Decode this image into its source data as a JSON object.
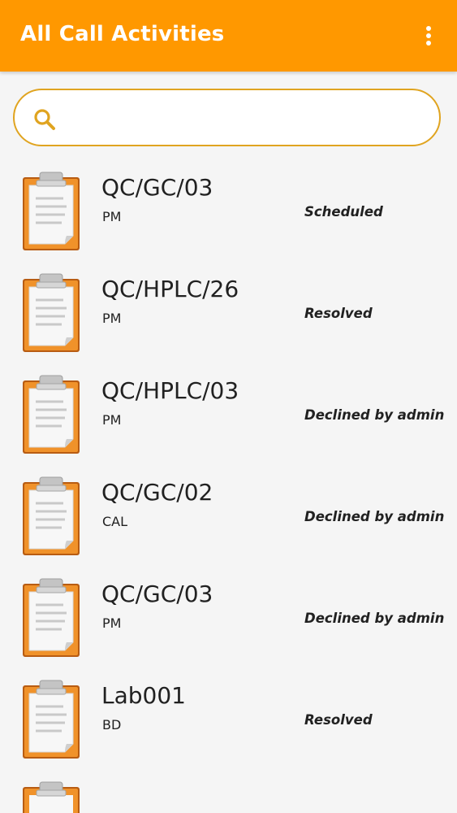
{
  "app_bar": {
    "title": "All Call Activities",
    "menu_icon": "more-vert-icon",
    "color": "#ff9800"
  },
  "search": {
    "icon": "search-icon",
    "value": "",
    "placeholder": "",
    "border_color": "#e0a420"
  },
  "activities": [
    {
      "title": "QC/GC/03",
      "type": "PM",
      "status": "Scheduled",
      "icon": "clipboard-icon"
    },
    {
      "title": "QC/HPLC/26",
      "type": "PM",
      "status": "Resolved",
      "icon": "clipboard-icon"
    },
    {
      "title": "QC/HPLC/03",
      "type": "PM",
      "status": "Declined by admin",
      "icon": "clipboard-icon"
    },
    {
      "title": "QC/GC/02",
      "type": "CAL",
      "status": "Declined by admin",
      "icon": "clipboard-icon"
    },
    {
      "title": "QC/GC/03",
      "type": "PM",
      "status": "Declined by admin",
      "icon": "clipboard-icon"
    },
    {
      "title": "Lab001",
      "type": "BD",
      "status": "Resolved",
      "icon": "clipboard-icon"
    }
  ]
}
